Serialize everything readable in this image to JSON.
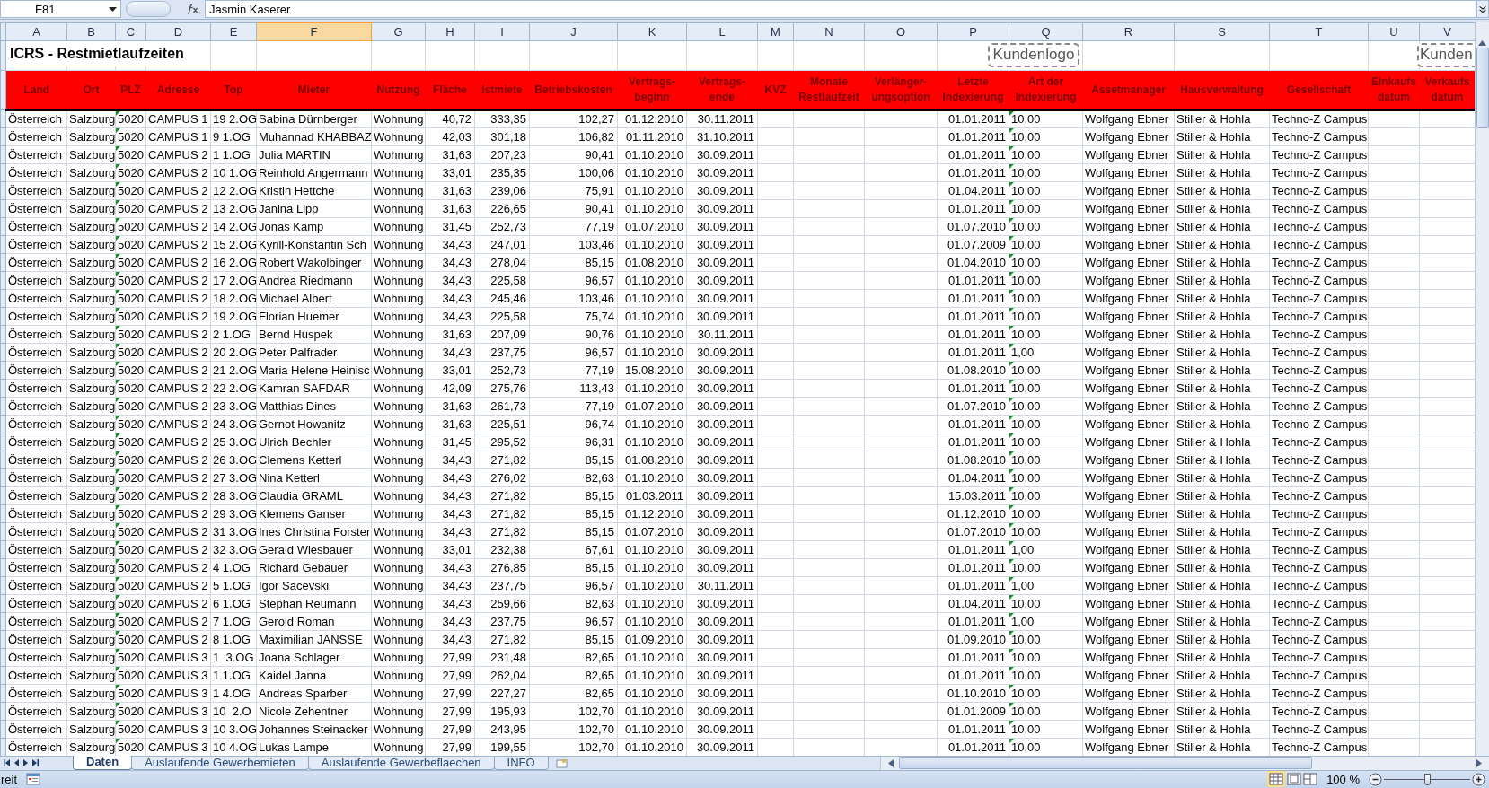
{
  "name_box": "F81",
  "formula": "Jasmin Kaserer",
  "columns": [
    {
      "letter": "A",
      "selected": false
    },
    {
      "letter": "B",
      "selected": false
    },
    {
      "letter": "C",
      "selected": false
    },
    {
      "letter": "D",
      "selected": false
    },
    {
      "letter": "E",
      "selected": false
    },
    {
      "letter": "F",
      "selected": true
    },
    {
      "letter": "G",
      "selected": false
    },
    {
      "letter": "H",
      "selected": false
    },
    {
      "letter": "I",
      "selected": false
    },
    {
      "letter": "J",
      "selected": false
    },
    {
      "letter": "K",
      "selected": false
    },
    {
      "letter": "L",
      "selected": false
    },
    {
      "letter": "M",
      "selected": false
    },
    {
      "letter": "N",
      "selected": false
    },
    {
      "letter": "O",
      "selected": false
    },
    {
      "letter": "P",
      "selected": false
    },
    {
      "letter": "Q",
      "selected": false
    },
    {
      "letter": "R",
      "selected": false
    },
    {
      "letter": "S",
      "selected": false
    },
    {
      "letter": "T",
      "selected": false
    },
    {
      "letter": "U",
      "selected": false
    },
    {
      "letter": "V",
      "selected": false
    }
  ],
  "title": "ICRS - Restmietlaufzeiten",
  "logos": [
    "Kundenlogo",
    "Kunden"
  ],
  "header": [
    "Land",
    "Ort",
    "PLZ",
    "Adresse",
    "Top",
    "Mieter",
    "Nutzung",
    "Fläche",
    "Istmiete",
    "Betriebskosten",
    "Vertrags-beginn",
    "Vertrags-ende",
    "KVZ",
    "Monate Restlaufzeit",
    "Verlänger-ungsoption",
    "Letzte Indexierung",
    "Art der Indexierung",
    "Assetmanager",
    "Hausverwaltung",
    "Gesellschaft",
    "Einkaufs datum",
    "Verkaufs datum"
  ],
  "rows": [
    {
      "land": "Österreich",
      "ort": "Salzburg",
      "plz": "5020",
      "adresse": "CAMPUS 1",
      "top": "19 2.OG",
      "mieter": "Sabina Dürnberger",
      "nutzung": "Wohnung",
      "flaeche": "40,72",
      "istmiete": "333,35",
      "betriebskosten": "102,27",
      "vertragsbeginn": "01.12.2010",
      "vertragsende": "30.11.2011",
      "letzte_indexierung": "01.01.2011",
      "art_der_indexierung": "10,00",
      "assetmanager": "Wolfgang Ebner",
      "hausverwaltung": "Stiller & Hohla",
      "gesellschaft": "Techno-Z Campus"
    },
    {
      "land": "Österreich",
      "ort": "Salzburg",
      "plz": "5020",
      "adresse": "CAMPUS 1",
      "top": "9 1.OG",
      "mieter": "Muhannad KHABBAZ",
      "nutzung": "Wohnung",
      "flaeche": "42,03",
      "istmiete": "301,18",
      "betriebskosten": "106,82",
      "vertragsbeginn": "01.11.2010",
      "vertragsende": "31.10.2011",
      "letzte_indexierung": "01.01.2011",
      "art_der_indexierung": "10,00",
      "assetmanager": "Wolfgang Ebner",
      "hausverwaltung": "Stiller & Hohla",
      "gesellschaft": "Techno-Z Campus"
    },
    {
      "land": "Österreich",
      "ort": "Salzburg",
      "plz": "5020",
      "adresse": "CAMPUS 2",
      "top": "1 1.OG",
      "mieter": "Julia MARTIN",
      "nutzung": "Wohnung",
      "flaeche": "31,63",
      "istmiete": "207,23",
      "betriebskosten": "90,41",
      "vertragsbeginn": "01.10.2010",
      "vertragsende": "30.09.2011",
      "letzte_indexierung": "01.01.2011",
      "art_der_indexierung": "10,00",
      "assetmanager": "Wolfgang Ebner",
      "hausverwaltung": "Stiller & Hohla",
      "gesellschaft": "Techno-Z Campus"
    },
    {
      "land": "Österreich",
      "ort": "Salzburg",
      "plz": "5020",
      "adresse": "CAMPUS 2",
      "top": "10 1.OG",
      "mieter": "Reinhold Angermann",
      "nutzung": "Wohnung",
      "flaeche": "33,01",
      "istmiete": "235,35",
      "betriebskosten": "100,06",
      "vertragsbeginn": "01.10.2010",
      "vertragsende": "30.09.2011",
      "letzte_indexierung": "01.01.2011",
      "art_der_indexierung": "10,00",
      "assetmanager": "Wolfgang Ebner",
      "hausverwaltung": "Stiller & Hohla",
      "gesellschaft": "Techno-Z Campus"
    },
    {
      "land": "Österreich",
      "ort": "Salzburg",
      "plz": "5020",
      "adresse": "CAMPUS 2",
      "top": "12 2.OG",
      "mieter": "Kristin Hettche",
      "nutzung": "Wohnung",
      "flaeche": "31,63",
      "istmiete": "239,06",
      "betriebskosten": "75,91",
      "vertragsbeginn": "01.10.2010",
      "vertragsende": "30.09.2011",
      "letzte_indexierung": "01.04.2011",
      "art_der_indexierung": "10,00",
      "assetmanager": "Wolfgang Ebner",
      "hausverwaltung": "Stiller & Hohla",
      "gesellschaft": "Techno-Z Campus"
    },
    {
      "land": "Österreich",
      "ort": "Salzburg",
      "plz": "5020",
      "adresse": "CAMPUS 2",
      "top": "13 2.OG",
      "mieter": "Janina Lipp",
      "nutzung": "Wohnung",
      "flaeche": "31,63",
      "istmiete": "226,65",
      "betriebskosten": "90,41",
      "vertragsbeginn": "01.10.2010",
      "vertragsende": "30.09.2011",
      "letzte_indexierung": "01.01.2011",
      "art_der_indexierung": "10,00",
      "assetmanager": "Wolfgang Ebner",
      "hausverwaltung": "Stiller & Hohla",
      "gesellschaft": "Techno-Z Campus"
    },
    {
      "land": "Österreich",
      "ort": "Salzburg",
      "plz": "5020",
      "adresse": "CAMPUS 2",
      "top": "14 2.OG",
      "mieter": "Jonas Kamp",
      "nutzung": "Wohnung",
      "flaeche": "31,45",
      "istmiete": "252,73",
      "betriebskosten": "77,19",
      "vertragsbeginn": "01.07.2010",
      "vertragsende": "30.09.2011",
      "letzte_indexierung": "01.07.2010",
      "art_der_indexierung": "10,00",
      "assetmanager": "Wolfgang Ebner",
      "hausverwaltung": "Stiller & Hohla",
      "gesellschaft": "Techno-Z Campus"
    },
    {
      "land": "Österreich",
      "ort": "Salzburg",
      "plz": "5020",
      "adresse": "CAMPUS 2",
      "top": "15 2.OG",
      "mieter": "Kyrill-Konstantin Sch",
      "nutzung": "Wohnung",
      "flaeche": "34,43",
      "istmiete": "247,01",
      "betriebskosten": "103,46",
      "vertragsbeginn": "01.10.2010",
      "vertragsende": "30.09.2011",
      "letzte_indexierung": "01.07.2009",
      "art_der_indexierung": "10,00",
      "assetmanager": "Wolfgang Ebner",
      "hausverwaltung": "Stiller & Hohla",
      "gesellschaft": "Techno-Z Campus"
    },
    {
      "land": "Österreich",
      "ort": "Salzburg",
      "plz": "5020",
      "adresse": "CAMPUS 2",
      "top": "16 2.OG",
      "mieter": "Robert Wakolbinger",
      "nutzung": "Wohnung",
      "flaeche": "34,43",
      "istmiete": "278,04",
      "betriebskosten": "85,15",
      "vertragsbeginn": "01.08.2010",
      "vertragsende": "30.09.2011",
      "letzte_indexierung": "01.04.2010",
      "art_der_indexierung": "10,00",
      "assetmanager": "Wolfgang Ebner",
      "hausverwaltung": "Stiller & Hohla",
      "gesellschaft": "Techno-Z Campus"
    },
    {
      "land": "Österreich",
      "ort": "Salzburg",
      "plz": "5020",
      "adresse": "CAMPUS 2",
      "top": "17 2.OG",
      "mieter": "Andrea Riedmann",
      "nutzung": "Wohnung",
      "flaeche": "34,43",
      "istmiete": "225,58",
      "betriebskosten": "96,57",
      "vertragsbeginn": "01.10.2010",
      "vertragsende": "30.09.2011",
      "letzte_indexierung": "01.01.2011",
      "art_der_indexierung": "10,00",
      "assetmanager": "Wolfgang Ebner",
      "hausverwaltung": "Stiller & Hohla",
      "gesellschaft": "Techno-Z Campus"
    },
    {
      "land": "Österreich",
      "ort": "Salzburg",
      "plz": "5020",
      "adresse": "CAMPUS 2",
      "top": "18 2.OG",
      "mieter": "Michael Albert",
      "nutzung": "Wohnung",
      "flaeche": "34,43",
      "istmiete": "245,46",
      "betriebskosten": "103,46",
      "vertragsbeginn": "01.10.2010",
      "vertragsende": "30.09.2011",
      "letzte_indexierung": "01.01.2011",
      "art_der_indexierung": "10,00",
      "assetmanager": "Wolfgang Ebner",
      "hausverwaltung": "Stiller & Hohla",
      "gesellschaft": "Techno-Z Campus"
    },
    {
      "land": "Österreich",
      "ort": "Salzburg",
      "plz": "5020",
      "adresse": "CAMPUS 2",
      "top": "19 2.OG",
      "mieter": "Florian Huemer",
      "nutzung": "Wohnung",
      "flaeche": "34,43",
      "istmiete": "225,58",
      "betriebskosten": "75,74",
      "vertragsbeginn": "01.10.2010",
      "vertragsende": "30.09.2011",
      "letzte_indexierung": "01.01.2011",
      "art_der_indexierung": "10,00",
      "assetmanager": "Wolfgang Ebner",
      "hausverwaltung": "Stiller & Hohla",
      "gesellschaft": "Techno-Z Campus"
    },
    {
      "land": "Österreich",
      "ort": "Salzburg",
      "plz": "5020",
      "adresse": "CAMPUS 2",
      "top": "2 1.OG",
      "mieter": "Bernd Huspek",
      "nutzung": "Wohnung",
      "flaeche": "31,63",
      "istmiete": "207,09",
      "betriebskosten": "90,76",
      "vertragsbeginn": "01.10.2010",
      "vertragsende": "30.11.2011",
      "letzte_indexierung": "01.01.2011",
      "art_der_indexierung": "10,00",
      "assetmanager": "Wolfgang Ebner",
      "hausverwaltung": "Stiller & Hohla",
      "gesellschaft": "Techno-Z Campus"
    },
    {
      "land": "Österreich",
      "ort": "Salzburg",
      "plz": "5020",
      "adresse": "CAMPUS 2",
      "top": "20 2.OG",
      "mieter": "Peter Palfrader",
      "nutzung": "Wohnung",
      "flaeche": "34,43",
      "istmiete": "237,75",
      "betriebskosten": "96,57",
      "vertragsbeginn": "01.10.2010",
      "vertragsende": "30.09.2011",
      "letzte_indexierung": "01.01.2011",
      "art_der_indexierung": "1,00",
      "assetmanager": "Wolfgang Ebner",
      "hausverwaltung": "Stiller & Hohla",
      "gesellschaft": "Techno-Z Campus"
    },
    {
      "land": "Österreich",
      "ort": "Salzburg",
      "plz": "5020",
      "adresse": "CAMPUS 2",
      "top": "21 2.OG",
      "mieter": "Maria Helene Heinisc",
      "nutzung": "Wohnung",
      "flaeche": "33,01",
      "istmiete": "252,73",
      "betriebskosten": "77,19",
      "vertragsbeginn": "15.08.2010",
      "vertragsende": "30.09.2011",
      "letzte_indexierung": "01.08.2010",
      "art_der_indexierung": "10,00",
      "assetmanager": "Wolfgang Ebner",
      "hausverwaltung": "Stiller & Hohla",
      "gesellschaft": "Techno-Z Campus"
    },
    {
      "land": "Österreich",
      "ort": "Salzburg",
      "plz": "5020",
      "adresse": "CAMPUS 2",
      "top": "22 2.OG",
      "mieter": "Kamran SAFDAR",
      "nutzung": "Wohnung",
      "flaeche": "42,09",
      "istmiete": "275,76",
      "betriebskosten": "113,43",
      "vertragsbeginn": "01.10.2010",
      "vertragsende": "30.09.2011",
      "letzte_indexierung": "01.01.2011",
      "art_der_indexierung": "10,00",
      "assetmanager": "Wolfgang Ebner",
      "hausverwaltung": "Stiller & Hohla",
      "gesellschaft": "Techno-Z Campus"
    },
    {
      "land": "Österreich",
      "ort": "Salzburg",
      "plz": "5020",
      "adresse": "CAMPUS 2",
      "top": "23 3.OG",
      "mieter": "Matthias Dines",
      "nutzung": "Wohnung",
      "flaeche": "31,63",
      "istmiete": "261,73",
      "betriebskosten": "77,19",
      "vertragsbeginn": "01.07.2010",
      "vertragsende": "30.09.2011",
      "letzte_indexierung": "01.07.2010",
      "art_der_indexierung": "10,00",
      "assetmanager": "Wolfgang Ebner",
      "hausverwaltung": "Stiller & Hohla",
      "gesellschaft": "Techno-Z Campus"
    },
    {
      "land": "Österreich",
      "ort": "Salzburg",
      "plz": "5020",
      "adresse": "CAMPUS 2",
      "top": "24 3.OG",
      "mieter": "Gernot Howanitz",
      "nutzung": "Wohnung",
      "flaeche": "31,63",
      "istmiete": "225,51",
      "betriebskosten": "96,74",
      "vertragsbeginn": "01.10.2010",
      "vertragsende": "30.09.2011",
      "letzte_indexierung": "01.01.2011",
      "art_der_indexierung": "10,00",
      "assetmanager": "Wolfgang Ebner",
      "hausverwaltung": "Stiller & Hohla",
      "gesellschaft": "Techno-Z Campus"
    },
    {
      "land": "Österreich",
      "ort": "Salzburg",
      "plz": "5020",
      "adresse": "CAMPUS 2",
      "top": "25 3.OG",
      "mieter": "Ulrich Bechler",
      "nutzung": "Wohnung",
      "flaeche": "31,45",
      "istmiete": "295,52",
      "betriebskosten": "96,31",
      "vertragsbeginn": "01.10.2010",
      "vertragsende": "30.09.2011",
      "letzte_indexierung": "01.01.2011",
      "art_der_indexierung": "10,00",
      "assetmanager": "Wolfgang Ebner",
      "hausverwaltung": "Stiller & Hohla",
      "gesellschaft": "Techno-Z Campus"
    },
    {
      "land": "Österreich",
      "ort": "Salzburg",
      "plz": "5020",
      "adresse": "CAMPUS 2",
      "top": "26 3.OG",
      "mieter": "Clemens Ketterl",
      "nutzung": "Wohnung",
      "flaeche": "34,43",
      "istmiete": "271,82",
      "betriebskosten": "85,15",
      "vertragsbeginn": "01.08.2010",
      "vertragsende": "30.09.2011",
      "letzte_indexierung": "01.08.2010",
      "art_der_indexierung": "10,00",
      "assetmanager": "Wolfgang Ebner",
      "hausverwaltung": "Stiller & Hohla",
      "gesellschaft": "Techno-Z Campus"
    },
    {
      "land": "Österreich",
      "ort": "Salzburg",
      "plz": "5020",
      "adresse": "CAMPUS 2",
      "top": "27 3.OG",
      "mieter": "Nina Ketterl",
      "nutzung": "Wohnung",
      "flaeche": "34,43",
      "istmiete": "276,02",
      "betriebskosten": "82,63",
      "vertragsbeginn": "01.10.2010",
      "vertragsende": "30.09.2011",
      "letzte_indexierung": "01.04.2011",
      "art_der_indexierung": "10,00",
      "assetmanager": "Wolfgang Ebner",
      "hausverwaltung": "Stiller & Hohla",
      "gesellschaft": "Techno-Z Campus"
    },
    {
      "land": "Österreich",
      "ort": "Salzburg",
      "plz": "5020",
      "adresse": "CAMPUS 2",
      "top": "28 3.OG",
      "mieter": "Claudia GRAML",
      "nutzung": "Wohnung",
      "flaeche": "34,43",
      "istmiete": "271,82",
      "betriebskosten": "85,15",
      "vertragsbeginn": "01.03.2011",
      "vertragsende": "30.09.2011",
      "letzte_indexierung": "15.03.2011",
      "art_der_indexierung": "10,00",
      "assetmanager": "Wolfgang Ebner",
      "hausverwaltung": "Stiller & Hohla",
      "gesellschaft": "Techno-Z Campus"
    },
    {
      "land": "Österreich",
      "ort": "Salzburg",
      "plz": "5020",
      "adresse": "CAMPUS 2",
      "top": "29 3.OG",
      "mieter": "Klemens Ganser",
      "nutzung": "Wohnung",
      "flaeche": "34,43",
      "istmiete": "271,82",
      "betriebskosten": "85,15",
      "vertragsbeginn": "01.12.2010",
      "vertragsende": "30.09.2011",
      "letzte_indexierung": "01.12.2010",
      "art_der_indexierung": "10,00",
      "assetmanager": "Wolfgang Ebner",
      "hausverwaltung": "Stiller & Hohla",
      "gesellschaft": "Techno-Z Campus"
    },
    {
      "land": "Österreich",
      "ort": "Salzburg",
      "plz": "5020",
      "adresse": "CAMPUS 2",
      "top": "31 3.OG",
      "mieter": "Ines Christina Forster",
      "nutzung": "Wohnung",
      "flaeche": "34,43",
      "istmiete": "271,82",
      "betriebskosten": "85,15",
      "vertragsbeginn": "01.07.2010",
      "vertragsende": "30.09.2011",
      "letzte_indexierung": "01.07.2010",
      "art_der_indexierung": "10,00",
      "assetmanager": "Wolfgang Ebner",
      "hausverwaltung": "Stiller & Hohla",
      "gesellschaft": "Techno-Z Campus"
    },
    {
      "land": "Österreich",
      "ort": "Salzburg",
      "plz": "5020",
      "adresse": "CAMPUS 2",
      "top": "32 3.OG",
      "mieter": "Gerald Wiesbauer",
      "nutzung": "Wohnung",
      "flaeche": "33,01",
      "istmiete": "232,38",
      "betriebskosten": "67,61",
      "vertragsbeginn": "01.10.2010",
      "vertragsende": "30.09.2011",
      "letzte_indexierung": "01.01.2011",
      "art_der_indexierung": "1,00",
      "assetmanager": "Wolfgang Ebner",
      "hausverwaltung": "Stiller & Hohla",
      "gesellschaft": "Techno-Z Campus"
    },
    {
      "land": "Österreich",
      "ort": "Salzburg",
      "plz": "5020",
      "adresse": "CAMPUS 2",
      "top": "4 1.OG",
      "mieter": "Richard Gebauer",
      "nutzung": "Wohnung",
      "flaeche": "34,43",
      "istmiete": "276,85",
      "betriebskosten": "85,15",
      "vertragsbeginn": "01.10.2010",
      "vertragsende": "30.09.2011",
      "letzte_indexierung": "01.01.2011",
      "art_der_indexierung": "10,00",
      "assetmanager": "Wolfgang Ebner",
      "hausverwaltung": "Stiller & Hohla",
      "gesellschaft": "Techno-Z Campus"
    },
    {
      "land": "Österreich",
      "ort": "Salzburg",
      "plz": "5020",
      "adresse": "CAMPUS 2",
      "top": "5 1.OG",
      "mieter": "Igor Sacevski",
      "nutzung": "Wohnung",
      "flaeche": "34,43",
      "istmiete": "237,75",
      "betriebskosten": "96,57",
      "vertragsbeginn": "01.10.2010",
      "vertragsende": "30.11.2011",
      "letzte_indexierung": "01.01.2011",
      "art_der_indexierung": "1,00",
      "assetmanager": "Wolfgang Ebner",
      "hausverwaltung": "Stiller & Hohla",
      "gesellschaft": "Techno-Z Campus"
    },
    {
      "land": "Österreich",
      "ort": "Salzburg",
      "plz": "5020",
      "adresse": "CAMPUS 2",
      "top": "6 1.OG",
      "mieter": "Stephan Reumann",
      "nutzung": "Wohnung",
      "flaeche": "34,43",
      "istmiete": "259,66",
      "betriebskosten": "82,63",
      "vertragsbeginn": "01.10.2010",
      "vertragsende": "30.09.2011",
      "letzte_indexierung": "01.04.2011",
      "art_der_indexierung": "10,00",
      "assetmanager": "Wolfgang Ebner",
      "hausverwaltung": "Stiller & Hohla",
      "gesellschaft": "Techno-Z Campus"
    },
    {
      "land": "Österreich",
      "ort": "Salzburg",
      "plz": "5020",
      "adresse": "CAMPUS 2",
      "top": "7 1.OG",
      "mieter": "Gerold Roman",
      "nutzung": "Wohnung",
      "flaeche": "34,43",
      "istmiete": "237,75",
      "betriebskosten": "96,57",
      "vertragsbeginn": "01.10.2010",
      "vertragsende": "30.09.2011",
      "letzte_indexierung": "01.01.2011",
      "art_der_indexierung": "1,00",
      "assetmanager": "Wolfgang Ebner",
      "hausverwaltung": "Stiller & Hohla",
      "gesellschaft": "Techno-Z Campus"
    },
    {
      "land": "Österreich",
      "ort": "Salzburg",
      "plz": "5020",
      "adresse": "CAMPUS 2",
      "top": "8 1.OG",
      "mieter": "Maximilian JANSSE",
      "nutzung": "Wohnung",
      "flaeche": "34,43",
      "istmiete": "271,82",
      "betriebskosten": "85,15",
      "vertragsbeginn": "01.09.2010",
      "vertragsende": "30.09.2011",
      "letzte_indexierung": "01.09.2010",
      "art_der_indexierung": "10,00",
      "assetmanager": "Wolfgang Ebner",
      "hausverwaltung": "Stiller & Hohla",
      "gesellschaft": "Techno-Z Campus"
    },
    {
      "land": "Österreich",
      "ort": "Salzburg",
      "plz": "5020",
      "adresse": "CAMPUS 3",
      "top": "1  3.OG",
      "mieter": "Joana Schlager",
      "nutzung": "Wohnung",
      "flaeche": "27,99",
      "istmiete": "231,48",
      "betriebskosten": "82,65",
      "vertragsbeginn": "01.10.2010",
      "vertragsende": "30.09.2011",
      "letzte_indexierung": "01.01.2011",
      "art_der_indexierung": "10,00",
      "assetmanager": "Wolfgang Ebner",
      "hausverwaltung": "Stiller & Hohla",
      "gesellschaft": "Techno-Z Campus"
    },
    {
      "land": "Österreich",
      "ort": "Salzburg",
      "plz": "5020",
      "adresse": "CAMPUS 3",
      "top": "1 1.OG",
      "mieter": "Kaidel Janna",
      "nutzung": "Wohnung",
      "flaeche": "27,99",
      "istmiete": "262,04",
      "betriebskosten": "82,65",
      "vertragsbeginn": "01.10.2010",
      "vertragsende": "30.09.2011",
      "letzte_indexierung": "01.01.2011",
      "art_der_indexierung": "10,00",
      "assetmanager": "Wolfgang Ebner",
      "hausverwaltung": "Stiller & Hohla",
      "gesellschaft": "Techno-Z Campus"
    },
    {
      "land": "Österreich",
      "ort": "Salzburg",
      "plz": "5020",
      "adresse": "CAMPUS 3",
      "top": "1 4.OG",
      "mieter": "Andreas Sparber",
      "nutzung": "Wohnung",
      "flaeche": "27,99",
      "istmiete": "227,27",
      "betriebskosten": "82,65",
      "vertragsbeginn": "01.10.2010",
      "vertragsende": "30.09.2011",
      "letzte_indexierung": "01.10.2010",
      "art_der_indexierung": "10,00",
      "assetmanager": "Wolfgang Ebner",
      "hausverwaltung": "Stiller & Hohla",
      "gesellschaft": "Techno-Z Campus"
    },
    {
      "land": "Österreich",
      "ort": "Salzburg",
      "plz": "5020",
      "adresse": "CAMPUS 3",
      "top": "10  2.O",
      "mieter": "Nicole Zehentner",
      "nutzung": "Wohnung",
      "flaeche": "27,99",
      "istmiete": "195,93",
      "betriebskosten": "102,70",
      "vertragsbeginn": "01.10.2010",
      "vertragsende": "30.09.2011",
      "letzte_indexierung": "01.01.2009",
      "art_der_indexierung": "10,00",
      "assetmanager": "Wolfgang Ebner",
      "hausverwaltung": "Stiller & Hohla",
      "gesellschaft": "Techno-Z Campus"
    },
    {
      "land": "Österreich",
      "ort": "Salzburg",
      "plz": "5020",
      "adresse": "CAMPUS 3",
      "top": "10 3.OG",
      "mieter": "Johannes Steinacker",
      "nutzung": "Wohnung",
      "flaeche": "27,99",
      "istmiete": "243,95",
      "betriebskosten": "102,70",
      "vertragsbeginn": "01.10.2010",
      "vertragsende": "30.09.2011",
      "letzte_indexierung": "01.01.2011",
      "art_der_indexierung": "10,00",
      "assetmanager": "Wolfgang Ebner",
      "hausverwaltung": "Stiller & Hohla",
      "gesellschaft": "Techno-Z Campus"
    },
    {
      "land": "Österreich",
      "ort": "Salzburg",
      "plz": "5020",
      "adresse": "CAMPUS 3",
      "top": "10 4.OG",
      "mieter": "Lukas Lampe",
      "nutzung": "Wohnung",
      "flaeche": "27,99",
      "istmiete": "199,55",
      "betriebskosten": "102,70",
      "vertragsbeginn": "01.10.2010",
      "vertragsende": "30.09.2011",
      "letzte_indexierung": "01.01.2011",
      "art_der_indexierung": "10,00",
      "assetmanager": "Wolfgang Ebner",
      "hausverwaltung": "Stiller & Hohla",
      "gesellschaft": "Techno-Z Campus"
    }
  ],
  "sheets": [
    {
      "label": "Daten",
      "selected": true
    },
    {
      "label": "Auslaufende Gewerbemieten",
      "selected": false
    },
    {
      "label": "Auslaufende Gewerbeflaechen",
      "selected": false
    },
    {
      "label": "INFO",
      "selected": false
    }
  ],
  "status": "reit",
  "zoom": {
    "label": "100 %",
    "level": 0.5
  }
}
